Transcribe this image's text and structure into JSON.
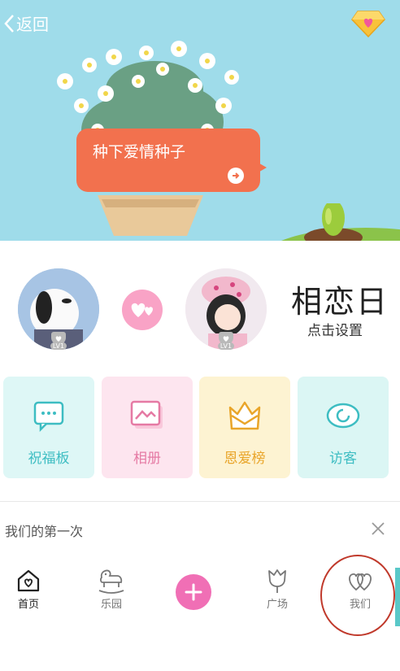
{
  "header": {
    "back_label": "返回",
    "diamond_icon": "diamond-heart-icon"
  },
  "hero": {
    "bubble_text": "种下爱情种子"
  },
  "couple": {
    "left_level": "LV1",
    "right_level": "LV1",
    "day_title": "相恋日",
    "day_action": "点击设置"
  },
  "tiles": [
    {
      "label": "祝福板",
      "icon": "message-dots-icon"
    },
    {
      "label": "相册",
      "icon": "photo-album-icon"
    },
    {
      "label": "恩爱榜",
      "icon": "crown-envelope-icon"
    },
    {
      "label": "访客",
      "icon": "eye-icon"
    }
  ],
  "section": {
    "first_time_title": "我们的第一次"
  },
  "nav": {
    "home": "首页",
    "park": "乐园",
    "plaza": "广场",
    "us": "我们"
  },
  "colors": {
    "bubble": "#f2714e",
    "accent_pink": "#f06fb5",
    "teal": "#3dbdc2"
  }
}
